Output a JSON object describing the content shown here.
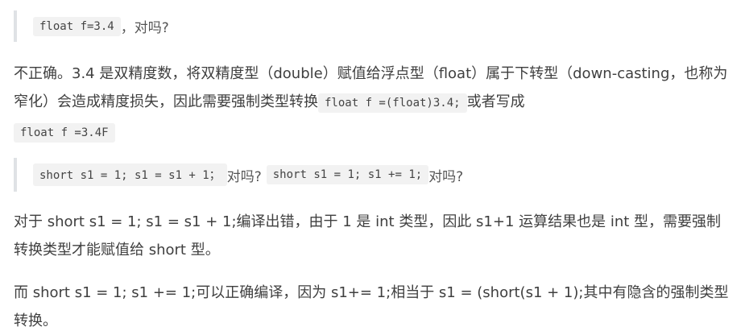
{
  "q1": {
    "code": "float f=3.4",
    "after": "，对吗?"
  },
  "p1": {
    "text1": "不正确。3.4 是双精度数，将双精度型（double）赋值给浮点型（float）属于下转型（down-casting，也称为窄化）会造成精度损失，因此需要强制类型转换",
    "code1": "float f =(float)3.4;",
    "text2": "或者写成",
    "code2": "float f =3.4F"
  },
  "q2": {
    "code1": "short s1 = 1; s1 = s1 + 1；",
    "text1": "对吗?",
    "code2": "short s1 = 1; s1 += 1;",
    "text2": "对吗?"
  },
  "p2": {
    "text": "对于 short s1 = 1; s1 = s1 + 1;编译出错，由于 1 是 int 类型，因此 s1+1 运算结果也是 int 型，需要强制转换类型才能赋值给 short 型。"
  },
  "p3": {
    "text": "而 short s1 = 1; s1 += 1;可以正确编译，因为 s1+= 1;相当于 s1 = (short(s1 + 1);其中有隐含的强制类型转换。"
  }
}
